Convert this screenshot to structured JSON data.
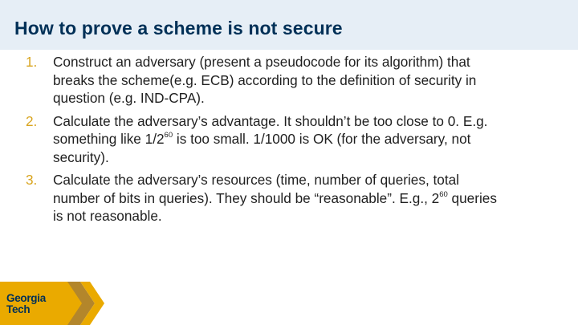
{
  "slide": {
    "title": "How to prove a scheme is not secure"
  },
  "items": [
    {
      "num": "1.",
      "line1": "Construct an adversary (present a pseudocode for its algorithm) that",
      "line2": "breaks the scheme(e.g. ECB) according to the definition of security in",
      "line3": "question (e.g. IND-CPA)."
    },
    {
      "num": "2.",
      "line1": "Calculate the adversary’s advantage. It shouldn’t be too close to 0. E.g.",
      "line2_a": "something like 1/2",
      "line2_sup": "60",
      "line2_b": " is too small. 1/1000 is OK (for the adversary, not",
      "line3": "security)."
    },
    {
      "num": "3.",
      "line1": "Calculate the adversary’s resources (time, number of queries, total",
      "line2_a": "number of bits in queries). They should be “reasonable”. E.g., 2",
      "line2_sup": "60",
      "line2_b": " queries",
      "line3": "is not reasonable."
    }
  ],
  "logo": {
    "line1": "Georgia",
    "line2": "Tech",
    "colors": {
      "gold": "#eaaa00",
      "gold_dark": "#b3862b",
      "navy": "#003057"
    }
  },
  "colors": {
    "title": "#003057",
    "header_band": "#e6eef6",
    "numbering": "#d9a520",
    "body_text": "#1f1f1f"
  }
}
